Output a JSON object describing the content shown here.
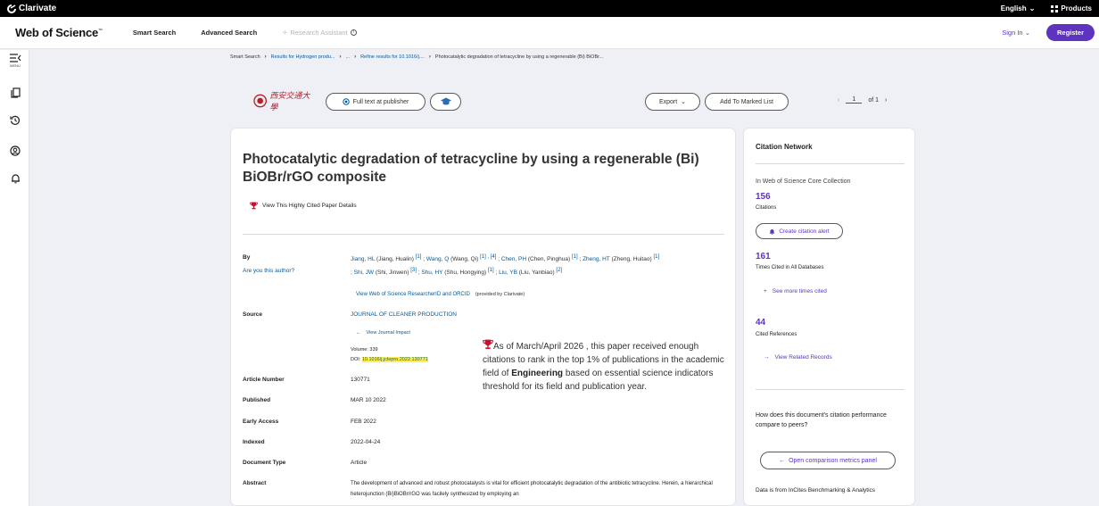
{
  "topbar": {
    "brand": "Clarivate",
    "language": "English",
    "products": "Products"
  },
  "header": {
    "logo": "Web of Science",
    "logo_tm": "™",
    "nav": {
      "smart_search": "Smart Search",
      "advanced_search": "Advanced Search",
      "research_assistant": "Research Assistant"
    },
    "sign_in": "Sign In",
    "register": "Register"
  },
  "rail": {
    "menu_label": "MENU"
  },
  "breadcrumb": {
    "items": [
      "Smart Search",
      "Results for Hydrogen produ...",
      "...",
      "Refine results for 10.1016/j....",
      "Photocatalytic degradation of tetracycline by using a regenerable (Bi) BiOBr..."
    ]
  },
  "actions": {
    "institution_logo_text": "西安交通大學",
    "full_text": "Full text at publisher",
    "export": "Export",
    "add_to_marked": "Add To Marked List",
    "page_current": "1",
    "page_of": "of 1"
  },
  "record": {
    "title": "Photocatalytic degradation of tetracycline by using a regenerable (Bi) BiOBr/rGO composite",
    "highly_cited": "View This Highly Cited Paper Details",
    "labels": {
      "by": "By",
      "are_you": "Are you this author?",
      "source": "Source",
      "article_number": "Article Number",
      "published": "Published",
      "early_access": "Early Access",
      "indexed": "Indexed",
      "document_type": "Document Type",
      "abstract": "Abstract"
    },
    "authors": [
      {
        "short": "Jiang, HL",
        "full": " (Jiang, Hualin) ",
        "aff": "[1]"
      },
      {
        "short": "Wang, Q",
        "full": " (Wang, Qi) ",
        "aff": "[1] , [4]"
      },
      {
        "short": "Chen, PH",
        "full": " (Chen, Pinghua) ",
        "aff": "[1]"
      },
      {
        "short": "Zheng, HT",
        "full": " (Zheng, Huitao) ",
        "aff": "[1]"
      },
      {
        "short": "Shi, JW",
        "full": " (Shi, Jinwen) ",
        "aff": "[3]"
      },
      {
        "short": "Shu, HY",
        "full": " (Shu, Hongying) ",
        "aff": "[1]"
      },
      {
        "short": "Liu, YB",
        "full": " (Liu, Yanbiao) ",
        "aff": "[2]"
      }
    ],
    "researcher_id": "View Web of Science ResearcherID and ORCID",
    "provided_by": "(provided by Clarivate)",
    "source": "JOURNAL OF CLEANER PRODUCTION",
    "journal_impact": "View Journal Impact",
    "volume": "Volume: 339",
    "doi_label": "DOI: ",
    "doi": "10.1016/j.jclepro.2022.130771",
    "esi_pre": "As of March/April 2026 , this paper received enough citations to rank in the top 1% of publications in the academic field of ",
    "esi_field": "Engineering",
    "esi_post": " based on essential science indicators threshold for its field and publication year.",
    "article_number": "130771",
    "published": "MAR 10 2022",
    "early_access": "FEB 2022",
    "indexed": "2022-04-24",
    "document_type": "Article",
    "abstract": "The development of advanced and robust photocatalysts is vital for efficient photocatalytic degradation of the antibiotic tetracycline. Herein, a hierarchical heterojunction (Bi)BiOBr/rGO was facilely synthesized by employing an"
  },
  "citation_network": {
    "title": "Citation Network",
    "core_collection": "In Web of Science Core Collection",
    "citations_count": "156",
    "citations_label": "Citations",
    "create_alert": "Create citation alert",
    "all_db_count": "161",
    "all_db_label": "Times Cited in All Databases",
    "see_more": "See more times cited",
    "cited_refs_count": "44",
    "cited_refs_label": "Cited References",
    "related": "View Related Records",
    "question": "How does this document's citation performance compare to peers?",
    "compare_btn": "Open comparison metrics panel",
    "footer": "Data is from InCites Benchmarking & Analytics"
  },
  "colors": {
    "accent": "#5e33bf",
    "link": "#005a9c",
    "highlight": "#ffef4f",
    "trophy": "#c8102e"
  }
}
